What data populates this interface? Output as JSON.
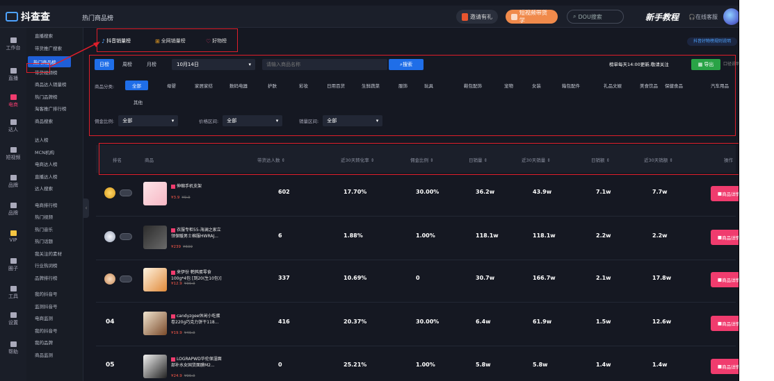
{
  "app": {
    "name": "抖查查",
    "page_title": "热门商品榜"
  },
  "header": {
    "btn_invite": "邀请有礼",
    "btn_promo": "短视频带货学",
    "search_placeholder": "DOU搜索",
    "newbie": "新手教程",
    "service": "在线客服"
  },
  "rail": [
    {
      "label": "工作台"
    },
    {
      "label": "直播"
    },
    {
      "label": "电商",
      "active": true
    },
    {
      "label": "达人"
    },
    {
      "label": "短视频"
    },
    {
      "label": "品牌"
    },
    {
      "label": "品牌"
    },
    {
      "label": "VIP"
    },
    {
      "label": "圈子"
    },
    {
      "label": "工具"
    },
    {
      "label": "设置"
    },
    {
      "label": "帮助"
    }
  ],
  "subnav": [
    "直播搜索",
    "带货推广搜索",
    "热门商品榜",
    "带货视频榜",
    "商品达人销量榜",
    "热门品牌榜",
    "淘客推广排行榜",
    "商品搜索",
    "达人榜",
    "MCN机构",
    "电商达人榜",
    "直播达人榜",
    "达人搜索",
    "电商排行榜",
    "热门视频",
    "热门音乐",
    "热门话题",
    "我关注的素材",
    "行业热词榜",
    "品牌排行榜",
    "我的抖音号",
    "监测抖音号",
    "电商监测",
    "我的抖音号",
    "我的品牌",
    "商品监测"
  ],
  "tabs": [
    "抖音销量榜",
    "全网销量榜",
    "好物榜"
  ],
  "right_link": "抖音好物榜规则说明",
  "filters": {
    "periods": [
      "日榜",
      "周榜",
      "月榜"
    ],
    "date": "10月14日",
    "search_placeholder": "请输入商品名称",
    "search_btn": "搜索",
    "update_note": "榜单每天14:00更新,敬请关注",
    "export": "导出",
    "guide": "口径说明",
    "category_label": "商品分类:",
    "categories": [
      "全部",
      "母婴",
      "家居家纺",
      "数码电器",
      "护肤",
      "彩妆",
      "日用百货",
      "生鲜蔬菜",
      "服饰",
      "玩具",
      "鞋包配饰",
      "宠物",
      "女装",
      "箱包配件",
      "礼品文娱",
      "美食饮品",
      "保健食品",
      "汽车用品"
    ],
    "category_extra": "其他",
    "selects": [
      {
        "label": "佣金比例:",
        "value": "全部"
      },
      {
        "label": "价格区间:",
        "value": "全部"
      },
      {
        "label": "销量区间:",
        "value": "全部"
      }
    ]
  },
  "table": {
    "headers": [
      "排名",
      "商品",
      "带货达人数 ⇕",
      "近30天转化率 ⇕",
      "佣金比例 ⇕",
      "日销量 ⇕",
      "近30天销量 ⇕",
      "日销额 ⇕",
      "近30天销额 ⇕",
      "操作"
    ],
    "action_label": "商品详情",
    "rows": [
      {
        "rank": "",
        "name": "伸缩手机支架",
        "price": "¥3.9",
        "old": "¥9.9",
        "talents": "602",
        "conv": "17.70%",
        "commission": "30.00%",
        "daily": "36.2w",
        "monthly": "43.9w",
        "daily_amt": "7.1w",
        "monthly_amt": "7.7w"
      },
      {
        "rank": "",
        "name": "衣服专柜55-海澜之家立领保暖男士棉服HWRAJ...",
        "price": "¥239",
        "old": "¥699",
        "talents": "6",
        "conv": "1.88%",
        "commission": "1.00%",
        "daily": "118.1w",
        "monthly": "118.1w",
        "daily_amt": "2.2w",
        "monthly_amt": "2.2w"
      },
      {
        "rank": "",
        "name": "来伊份 鹌鹑蛋零食100g*4包 [到20(生10包)]",
        "price": "¥12.9",
        "old": "¥39.9",
        "talents": "337",
        "conv": "10.69%",
        "commission": "0",
        "daily": "30.7w",
        "monthly": "166.7w",
        "daily_amt": "2.1w",
        "monthly_amt": "17.8w"
      },
      {
        "rank": "04",
        "name": "candyzgee休闲小吃蛋卷220g巧克力饼干118...",
        "price": "¥19.9",
        "old": "¥49.9",
        "talents": "416",
        "conv": "20.37%",
        "commission": "30.00%",
        "daily": "6.4w",
        "monthly": "61.9w",
        "daily_amt": "1.5w",
        "monthly_amt": "12.6w"
      },
      {
        "rank": "05",
        "name": "LOGRAPWD华伦保湿面部补水女国货面膜M2...",
        "price": "¥24.9",
        "old": "¥99.9",
        "talents": "0",
        "conv": "25.21%",
        "commission": "1.00%",
        "daily": "5.8w",
        "monthly": "5.8w",
        "daily_amt": "1.4w",
        "monthly_amt": "1.4w"
      }
    ]
  },
  "colors": {
    "accent": "#1f6ee8",
    "pink": "#f03c6e",
    "annotation": "#e01e2a"
  }
}
